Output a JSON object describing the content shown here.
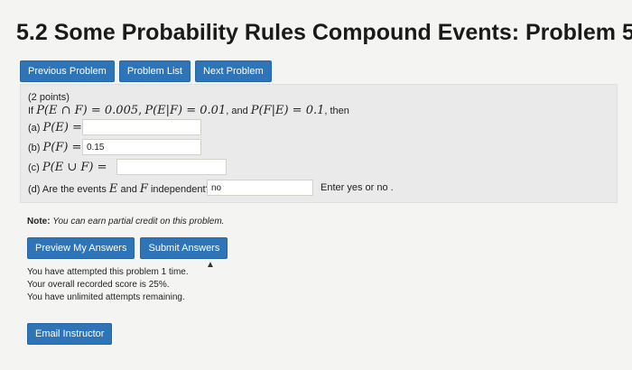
{
  "title": "5.2 Some Probability Rules Compound Events: Problem 5",
  "nav": {
    "previous": "Previous Problem",
    "list": "Problem List",
    "next": "Next Problem"
  },
  "problem": {
    "points": "(2 points)",
    "intro_if": "If",
    "given1": "P(E ∩ F) = 0.005",
    "given2": "P(E|F) = 0.01",
    "and_word": ", and",
    "given3": "P(F|E) = 0.1",
    "then_word": ", then",
    "a_label": "(a)",
    "a_expr": "P(E) =",
    "a_value": "",
    "b_label": "(b)",
    "b_expr": "P(F) =",
    "b_value": "0.15",
    "c_label": "(c)",
    "c_expr": "P(E ∪ F) =",
    "c_value": "",
    "d_text_pre": "(d) Are the events",
    "d_E": "E",
    "d_and": "and",
    "d_F": "F",
    "d_text_post": "independent?",
    "d_value": "no",
    "d_hint": "Enter yes or no ."
  },
  "note": {
    "label": "Note:",
    "text": "You can earn partial credit on this problem."
  },
  "actions": {
    "preview": "Preview My Answers",
    "submit": "Submit Answers"
  },
  "status": {
    "attempts": "You have attempted this problem 1 time.",
    "score": "Your overall recorded score is 25%.",
    "remaining": "You have unlimited attempts remaining."
  },
  "email": "Email Instructor",
  "colors": {
    "button": "#2e74b8",
    "panel": "#eaeaea",
    "background": "#f4f4f2"
  }
}
